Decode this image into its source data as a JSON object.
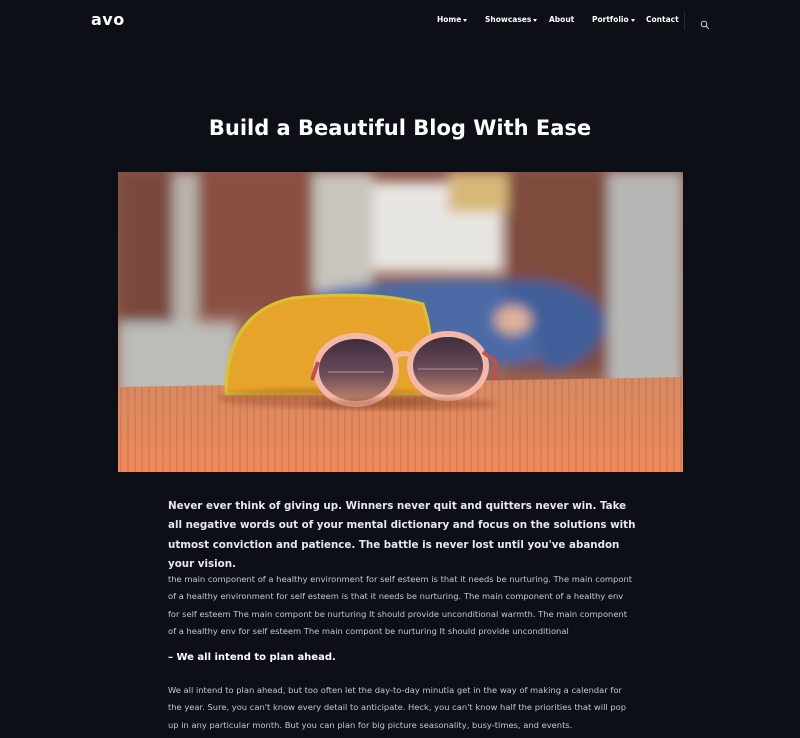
{
  "header": {
    "logo": "avo",
    "nav": [
      {
        "label": "Home",
        "has_dropdown": true
      },
      {
        "label": "Showcases",
        "has_dropdown": true
      },
      {
        "label": "About",
        "has_dropdown": false
      },
      {
        "label": "Portfolio",
        "has_dropdown": true
      },
      {
        "label": "Contact",
        "has_dropdown": false
      }
    ],
    "search_icon": "search-icon"
  },
  "post": {
    "title": "Build a Beautiful Blog With Ease",
    "hero_image": "sunglasses-on-orange-case-photo",
    "lead": "Never ever think of giving up. Winners never quit and quitters never win. Take all negative words out of your mental dictionary and focus on the solutions with utmost conviction and patience. The battle is never lost until you've abandon your vision.",
    "paragraph1": "the main component of a healthy environment for self esteem is that it needs be nurturing. The main compont of a healthy environment for self esteem is that it needs be nurturing. The main component of a healthy env for self esteem The main compont be nurturing It should provide unconditional warmth. The main component of a healthy env for self esteem The main compont be nurturing It should provide unconditional",
    "subheading": "– We all intend to plan ahead.",
    "paragraph2": "We all intend to plan ahead, but too often let the day-to-day minutia get in the way of making a calendar for the year. Sure, you can't know every detail to anticipate. Heck, you can't know half the priorities that will pop up in any particular month. But you can plan for big picture seasonality, busy-times, and events."
  },
  "colors": {
    "background": "#0c0f16",
    "text": "#ffffff",
    "body_text": "#c4c8d2"
  }
}
